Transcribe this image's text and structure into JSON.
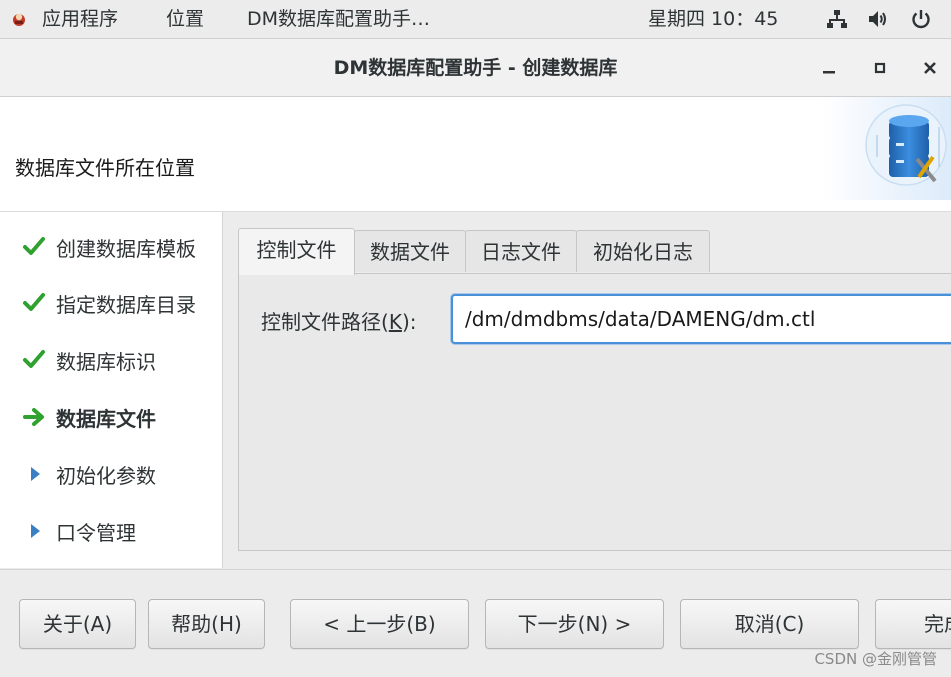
{
  "topbar": {
    "apps": "应用程序",
    "places": "位置",
    "window_title": "DM数据库配置助手…",
    "clock": "星期四 10：45"
  },
  "titlebar": {
    "title": "DM数据库配置助手 - 创建数据库"
  },
  "header": {
    "heading": "数据库文件所在位置"
  },
  "nav": {
    "items": [
      {
        "label": "创建数据库模板",
        "state": "done"
      },
      {
        "label": "指定数据库目录",
        "state": "done"
      },
      {
        "label": "数据库标识",
        "state": "done"
      },
      {
        "label": "数据库文件",
        "state": "current"
      },
      {
        "label": "初始化参数",
        "state": "pending"
      },
      {
        "label": "口令管理",
        "state": "pending"
      }
    ]
  },
  "tabs": {
    "items": [
      {
        "label": "控制文件",
        "active": true
      },
      {
        "label": "数据文件",
        "active": false
      },
      {
        "label": "日志文件",
        "active": false
      },
      {
        "label": "初始化日志",
        "active": false
      }
    ]
  },
  "control_file": {
    "label_prefix": "控制文件路径(",
    "mnemonic": "K",
    "label_suffix": "):",
    "value": "/dm/dmdbms/data/DAMENG/dm.ctl"
  },
  "buttons": {
    "about": "关于(A)",
    "help": "帮助(H)",
    "back": "< 上一步(B)",
    "next": "下一步(N) >",
    "cancel": "取消(C)",
    "finish": "完成(F)"
  },
  "watermark": "CSDN @金刚管管",
  "colors": {
    "check": "#2fa12f",
    "arrow_current": "#2fa12f",
    "triangle_pending": "#3a7fc4",
    "focus_border": "#4a90d9"
  }
}
